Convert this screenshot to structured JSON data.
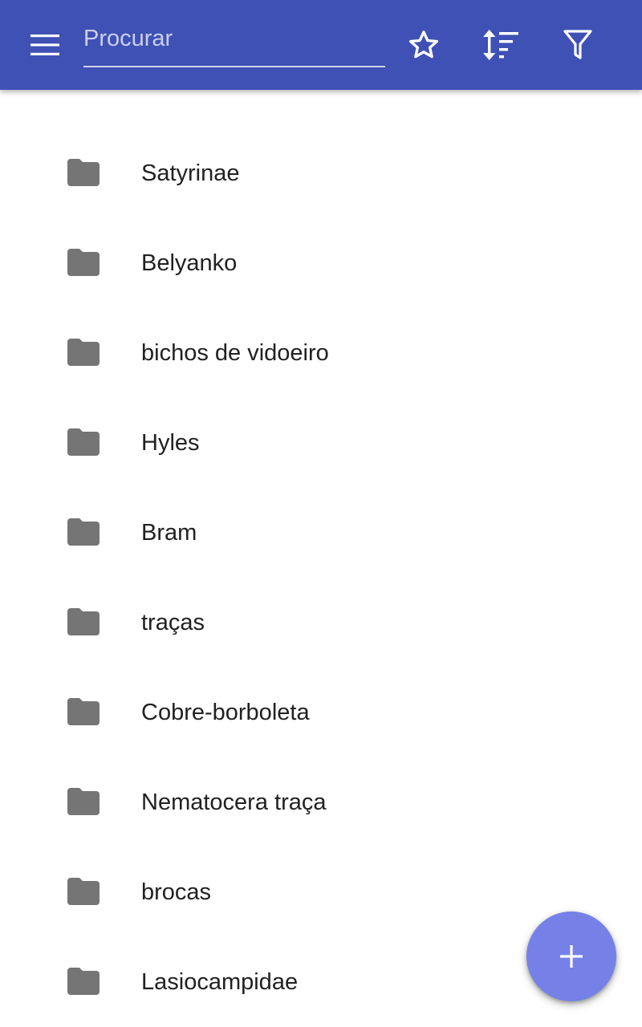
{
  "toolbar": {
    "background_color": "#3f51b5",
    "menu_icon": "menu-icon",
    "search": {
      "placeholder": "Procurar",
      "value": ""
    },
    "favorites_icon": "star-outline-icon",
    "sort_icon": "sort-icon",
    "filter_icon": "filter-icon"
  },
  "folders": [
    {
      "label": "Satyrinae",
      "icon": "folder-icon"
    },
    {
      "label": "Belyanko",
      "icon": "folder-icon"
    },
    {
      "label": "bichos de vidoeiro",
      "icon": "folder-icon"
    },
    {
      "label": "Hyles",
      "icon": "folder-icon"
    },
    {
      "label": "Bram",
      "icon": "folder-icon"
    },
    {
      "label": "traças",
      "icon": "folder-icon"
    },
    {
      "label": "Cobre-borboleta",
      "icon": "folder-icon"
    },
    {
      "label": "Nematocera traça",
      "icon": "folder-icon"
    },
    {
      "label": "brocas",
      "icon": "folder-icon"
    },
    {
      "label": "Lasiocampidae",
      "icon": "folder-icon"
    }
  ],
  "fab": {
    "icon": "plus-icon",
    "color": "#7581e6"
  },
  "colors": {
    "folder_icon": "#757575",
    "text_primary": "#212121"
  }
}
